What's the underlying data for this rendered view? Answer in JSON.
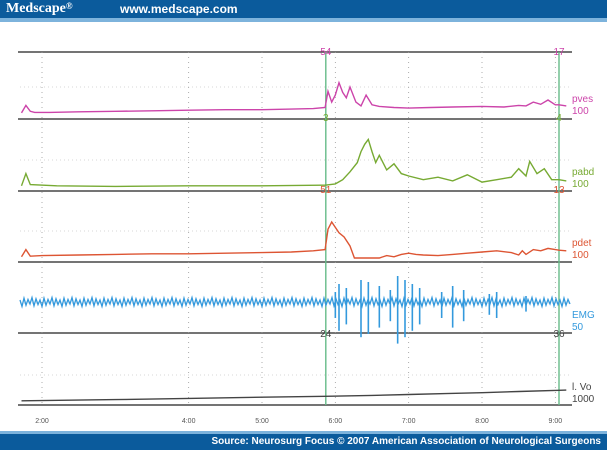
{
  "header": {
    "brand": "Medscape",
    "brand_mark": "®",
    "url": "www.medscape.com"
  },
  "footer": {
    "source": "Source: Neurosurg Focus © 2007 American Association of Neurological Surgeons"
  },
  "chart_data": {
    "type": "line",
    "title": "",
    "x_ticks": [
      "2:00",
      "4:00",
      "5:00",
      "6:00",
      "7:00",
      "8:00",
      "9:00"
    ],
    "x_tick_positions_min": [
      2,
      4,
      5,
      6,
      7,
      8,
      9
    ],
    "xlim": [
      1.7,
      9.2
    ],
    "marker_left_x": 5.87,
    "marker_right_x": 9.05,
    "channels": [
      {
        "name": "pves",
        "scale": "100",
        "color": "#cc44aa",
        "marker_left_value": "54",
        "marker_right_value": "17",
        "ylim": [
          0,
          100
        ],
        "points": [
          [
            1.72,
            2
          ],
          [
            1.78,
            16
          ],
          [
            1.84,
            5
          ],
          [
            1.9,
            3
          ],
          [
            2.1,
            3
          ],
          [
            2.5,
            4
          ],
          [
            3.0,
            5
          ],
          [
            3.5,
            6
          ],
          [
            4.0,
            7
          ],
          [
            4.5,
            8
          ],
          [
            5.0,
            8
          ],
          [
            5.4,
            9
          ],
          [
            5.7,
            10
          ],
          [
            5.86,
            12
          ],
          [
            5.9,
            42
          ],
          [
            5.95,
            22
          ],
          [
            6.0,
            35
          ],
          [
            6.05,
            58
          ],
          [
            6.1,
            40
          ],
          [
            6.15,
            30
          ],
          [
            6.2,
            50
          ],
          [
            6.28,
            22
          ],
          [
            6.35,
            15
          ],
          [
            6.42,
            35
          ],
          [
            6.5,
            17
          ],
          [
            6.6,
            14
          ],
          [
            6.8,
            12
          ],
          [
            7.0,
            11
          ],
          [
            7.3,
            12
          ],
          [
            7.6,
            13
          ],
          [
            8.0,
            14
          ],
          [
            8.3,
            13
          ],
          [
            8.5,
            16
          ],
          [
            8.6,
            15
          ],
          [
            8.7,
            22
          ],
          [
            8.8,
            18
          ],
          [
            8.9,
            26
          ],
          [
            9.0,
            17
          ],
          [
            9.05,
            17
          ],
          [
            9.15,
            15
          ]
        ]
      },
      {
        "name": "pabd",
        "scale": "100",
        "color": "#77aa33",
        "marker_left_value": "3",
        "marker_right_value": "4",
        "ylim": [
          0,
          100
        ],
        "points": [
          [
            1.72,
            2
          ],
          [
            1.78,
            22
          ],
          [
            1.84,
            4
          ],
          [
            2.2,
            2
          ],
          [
            3.0,
            1
          ],
          [
            4.0,
            2
          ],
          [
            5.0,
            2
          ],
          [
            5.8,
            3
          ],
          [
            5.86,
            3
          ],
          [
            6.0,
            5
          ],
          [
            6.1,
            12
          ],
          [
            6.2,
            25
          ],
          [
            6.3,
            40
          ],
          [
            6.35,
            58
          ],
          [
            6.4,
            70
          ],
          [
            6.45,
            78
          ],
          [
            6.5,
            58
          ],
          [
            6.55,
            40
          ],
          [
            6.6,
            52
          ],
          [
            6.7,
            28
          ],
          [
            6.8,
            38
          ],
          [
            6.9,
            22
          ],
          [
            7.0,
            18
          ],
          [
            7.2,
            12
          ],
          [
            7.4,
            16
          ],
          [
            7.6,
            10
          ],
          [
            7.8,
            20
          ],
          [
            8.0,
            8
          ],
          [
            8.2,
            12
          ],
          [
            8.4,
            16
          ],
          [
            8.5,
            30
          ],
          [
            8.6,
            18
          ],
          [
            8.65,
            42
          ],
          [
            8.75,
            22
          ],
          [
            8.85,
            30
          ],
          [
            8.95,
            12
          ],
          [
            9.05,
            12
          ],
          [
            9.15,
            10
          ]
        ]
      },
      {
        "name": "pdet",
        "scale": "100",
        "color": "#dd5533",
        "marker_left_value": "51",
        "marker_right_value": "13",
        "ylim": [
          0,
          100
        ],
        "points": [
          [
            1.72,
            2
          ],
          [
            1.78,
            14
          ],
          [
            1.84,
            3
          ],
          [
            2.0,
            4
          ],
          [
            2.5,
            5
          ],
          [
            3.0,
            6
          ],
          [
            3.5,
            7
          ],
          [
            4.0,
            7
          ],
          [
            4.5,
            8
          ],
          [
            5.0,
            9
          ],
          [
            5.4,
            10
          ],
          [
            5.7,
            12
          ],
          [
            5.86,
            14
          ],
          [
            5.9,
            48
          ],
          [
            5.95,
            60
          ],
          [
            6.05,
            42
          ],
          [
            6.12,
            35
          ],
          [
            6.2,
            20
          ],
          [
            6.26,
            0
          ],
          [
            6.3,
            0
          ],
          [
            6.5,
            0
          ],
          [
            6.6,
            0
          ],
          [
            6.7,
            4
          ],
          [
            6.8,
            2
          ],
          [
            6.9,
            6
          ],
          [
            7.0,
            8
          ],
          [
            7.1,
            6
          ],
          [
            7.2,
            5
          ],
          [
            7.4,
            4
          ],
          [
            7.6,
            6
          ],
          [
            7.8,
            8
          ],
          [
            8.0,
            10
          ],
          [
            8.2,
            12
          ],
          [
            8.4,
            9
          ],
          [
            8.5,
            5
          ],
          [
            8.55,
            12
          ],
          [
            8.6,
            6
          ],
          [
            8.7,
            14
          ],
          [
            8.8,
            12
          ],
          [
            8.9,
            16
          ],
          [
            9.0,
            14
          ],
          [
            9.05,
            13
          ],
          [
            9.15,
            12
          ]
        ]
      },
      {
        "name": "EMG",
        "scale": "50",
        "color": "#3399dd",
        "spikes_x": [
          6.0,
          6.05,
          6.15,
          6.35,
          6.45,
          6.6,
          6.75,
          6.85,
          6.95,
          7.05,
          7.15,
          7.45,
          7.6,
          7.75,
          8.1,
          8.2,
          8.6
        ],
        "spikes_amp": [
          10,
          18,
          14,
          22,
          20,
          16,
          12,
          26,
          22,
          18,
          14,
          10,
          16,
          12,
          8,
          10,
          6
        ]
      },
      {
        "name": "l. Vo",
        "scale": "1000",
        "color": "#444444",
        "marker_left_value": "24",
        "marker_right_value": "36",
        "ylim": [
          0,
          1000
        ],
        "points": [
          [
            1.72,
            20
          ],
          [
            3.0,
            40
          ],
          [
            4.0,
            60
          ],
          [
            5.0,
            80
          ],
          [
            5.86,
            95
          ],
          [
            6.5,
            110
          ],
          [
            7.0,
            125
          ],
          [
            7.5,
            140
          ],
          [
            8.0,
            155
          ],
          [
            8.5,
            175
          ],
          [
            9.05,
            195
          ],
          [
            9.15,
            198
          ]
        ]
      }
    ]
  }
}
